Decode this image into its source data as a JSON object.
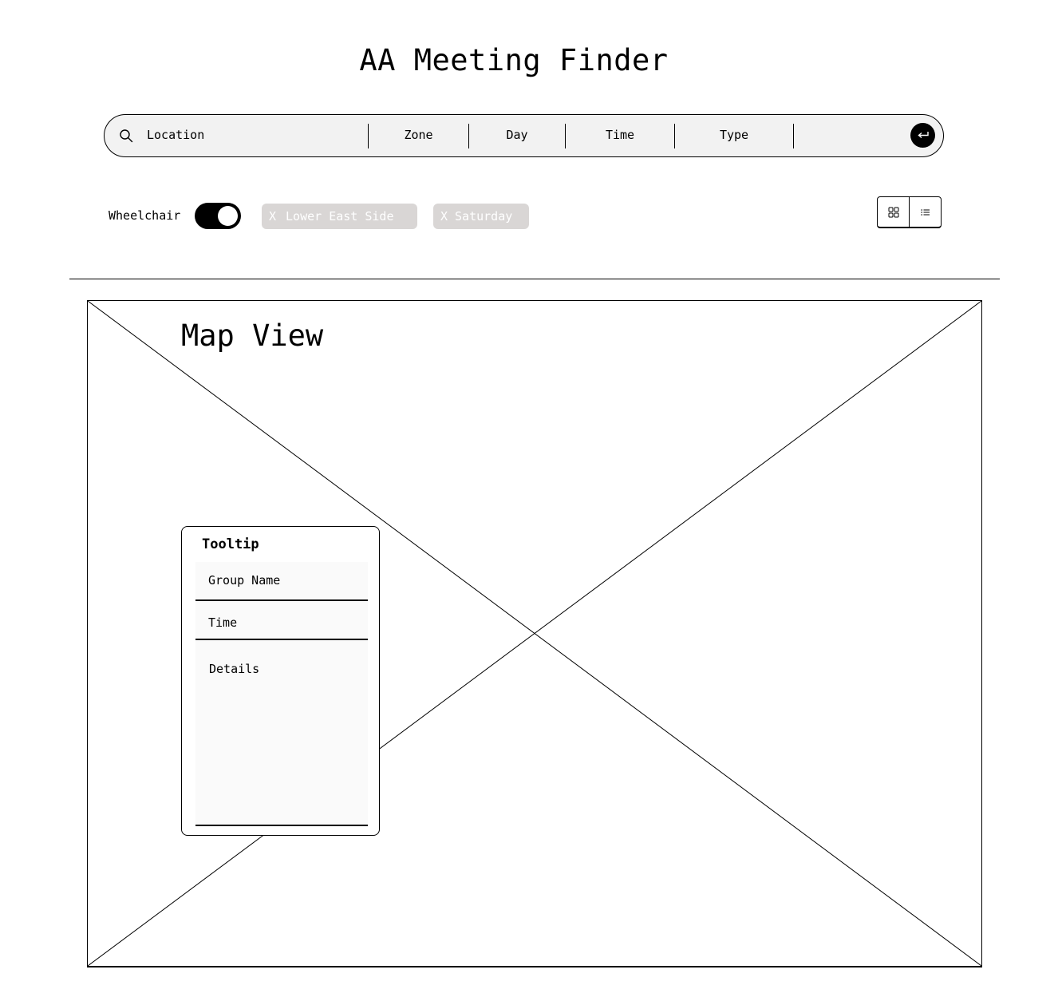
{
  "header": {
    "title": "AA Meeting Finder"
  },
  "search": {
    "location_label": "Location",
    "zone_label": "Zone",
    "day_label": "Day",
    "time_label": "Time",
    "type_label": "Type",
    "submit_icon": "enter-icon"
  },
  "filters": {
    "wheelchair_label": "Wheelchair",
    "wheelchair_on": true,
    "chips": [
      {
        "x": "X",
        "label": "Lower East Side"
      },
      {
        "x": "X",
        "label": "Saturday"
      }
    ],
    "view_icons": [
      "grid-view-icon",
      "list-view-icon"
    ]
  },
  "map": {
    "title": "Map View",
    "tooltip": {
      "title": "Tooltip",
      "group_name": "Group Name",
      "time": "Time",
      "details": "Details"
    }
  }
}
